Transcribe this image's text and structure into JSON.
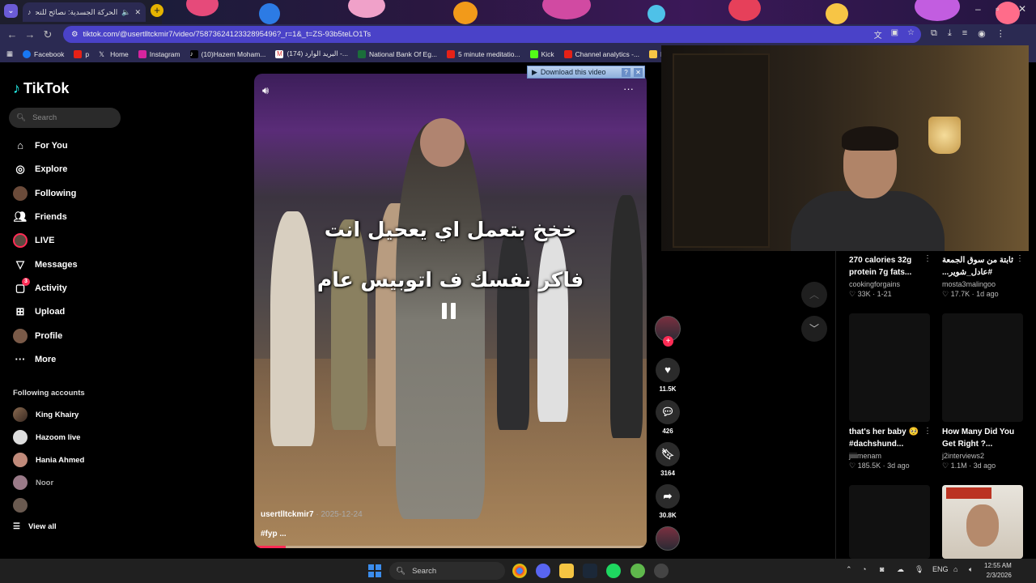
{
  "browser": {
    "tab_title": "الحركة الجسدية: نصائح للتحك...",
    "url": "tiktok.com/@usertlltckmir7/video/7587362412332895496?_r=1&_t=ZS-93b5teLO1Ts",
    "bookmarks": [
      "Facebook",
      "p",
      "Home",
      "Instagram",
      "(10)Hazem Moham...",
      "(174) البريد الوارد -...",
      "National Bank Of Eg...",
      "5 minute meditatio...",
      "Kick",
      "Channel analytics -...",
      "Ho"
    ]
  },
  "tiktok": {
    "logo": "TikTok",
    "search_placeholder": "Search",
    "nav": [
      "For You",
      "Explore",
      "Following",
      "Friends",
      "LIVE",
      "Messages",
      "Activity",
      "Upload",
      "Profile",
      "More"
    ],
    "activity_badge": "3",
    "following_heading": "Following accounts",
    "accounts": [
      "King Khairy",
      "Hazoom live",
      "Hania Ahmed",
      "Noor",
      ""
    ],
    "view_all": "View all"
  },
  "video": {
    "caption_line1": "خخخ بتعمل اي يعحيل انت",
    "caption_line2": "فاكر نفسك ف اتوبيس عام",
    "author": "usertlltckmir7",
    "date": "· 2025-12-24",
    "tag": "#fyp ...",
    "progress": 0.08,
    "download_label": "Download this video",
    "likes": "11.5K",
    "comments": "426",
    "saves": "3164",
    "shares": "30.8K"
  },
  "suggestions": [
    {
      "title": "270 calories 32g protein 7g fats...",
      "author": "cookingforgains",
      "likes": "33K",
      "date": "1-21"
    },
    {
      "title": "ثابتة من سوق الجمعة #عادل_شوير...",
      "author": "mosta3malingoo",
      "likes": "17.7K",
      "date": "1d ago"
    },
    {
      "title": "that's her baby 🥺 #dachshund...",
      "author": "jiiiimenam",
      "likes": "185.5K",
      "date": "3d ago"
    },
    {
      "title": "How Many Did You Get Right ?...",
      "author": "j2interviews2",
      "likes": "1.1M",
      "date": "3d ago"
    }
  ],
  "taskbar": {
    "search_placeholder": "Search",
    "lang": "ENG",
    "time": "12:55 AM",
    "date": "2/3/2026"
  },
  "icons": {
    "back": "back-arrow-icon",
    "forward": "forward-arrow-icon",
    "reload": "reload-icon",
    "pause": "pause-icon",
    "like": "heart-icon",
    "comment": "comment-icon",
    "save": "bookmark-icon",
    "share": "share-icon"
  },
  "colors": {
    "brand_red": "#fe2c55",
    "omnibox": "#4a42c8"
  }
}
